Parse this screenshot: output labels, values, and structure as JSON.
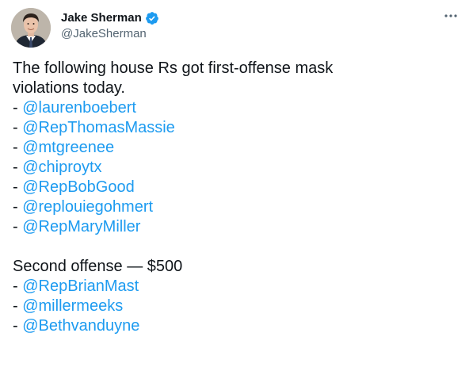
{
  "author": {
    "display_name": "Jake Sherman",
    "handle": "@JakeSherman",
    "verified": true
  },
  "icons": {
    "verified": "verified-badge-icon",
    "more": "more-options-icon"
  },
  "colors": {
    "text": "#0f1419",
    "secondary": "#536471",
    "mention": "#1d9bf0",
    "verified": "#1d9bf0"
  },
  "tweet": {
    "intro_line1": "The following house Rs got first-offense mask",
    "intro_line2": "violations today.",
    "bullet": "- ",
    "first_offense_mentions": [
      "@laurenboebert",
      "@RepThomasMassie",
      "@mtgreenee",
      "@chiproytx",
      "@RepBobGood",
      "@replouiegohmert",
      "@RepMaryMiller"
    ],
    "second_offense_heading": "Second offense — $500",
    "second_offense_mentions": [
      "@RepBrianMast",
      "@millermeeks",
      "@Bethvanduyne"
    ]
  }
}
